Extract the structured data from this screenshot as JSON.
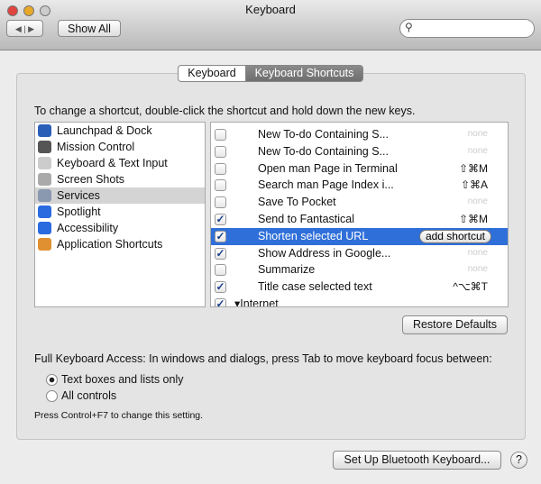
{
  "window": {
    "title": "Keyboard"
  },
  "toolbar": {
    "show_all": "Show All",
    "search_placeholder": ""
  },
  "tabs": [
    {
      "label": "Keyboard",
      "selected": false
    },
    {
      "label": "Keyboard Shortcuts",
      "selected": true
    }
  ],
  "instruction": "To change a shortcut, double-click the shortcut and hold down the new keys.",
  "categories": [
    {
      "label": "Launchpad & Dock",
      "icon": "launchpad-icon",
      "color": "#2a5fb8"
    },
    {
      "label": "Mission Control",
      "icon": "mission-control-icon",
      "color": "#555"
    },
    {
      "label": "Keyboard & Text Input",
      "icon": "keyboard-icon",
      "color": "#ccc"
    },
    {
      "label": "Screen Shots",
      "icon": "screenshot-icon",
      "color": "#aaa"
    },
    {
      "label": "Services",
      "icon": "gear-icon",
      "color": "#8a99b0",
      "selected": true
    },
    {
      "label": "Spotlight",
      "icon": "spotlight-icon",
      "color": "#2b6be0"
    },
    {
      "label": "Accessibility",
      "icon": "accessibility-icon",
      "color": "#2b6be0"
    },
    {
      "label": "Application Shortcuts",
      "icon": "app-shortcuts-icon",
      "color": "#e09030"
    }
  ],
  "shortcuts": [
    {
      "name": "New To-do Containing S...",
      "checked": false,
      "key": "none"
    },
    {
      "name": "New To-do Containing S...",
      "checked": false,
      "key": "none"
    },
    {
      "name": "Open man Page in Terminal",
      "checked": false,
      "key": "⇧⌘M"
    },
    {
      "name": "Search man Page Index i...",
      "checked": false,
      "key": "⇧⌘A"
    },
    {
      "name": "Save To Pocket",
      "checked": false,
      "key": "none"
    },
    {
      "name": "Send to Fantastical",
      "checked": true,
      "key": "⇧⌘M"
    },
    {
      "name": "Shorten selected URL",
      "checked": true,
      "key": "add shortcut",
      "selected": true
    },
    {
      "name": "Show Address in Google...",
      "checked": true,
      "key": "none"
    },
    {
      "name": "Summarize",
      "checked": false,
      "key": "none"
    },
    {
      "name": "Title case selected text",
      "checked": true,
      "key": "^⌥⌘T"
    },
    {
      "name": "▾Internet",
      "checked": true,
      "key": "",
      "group": true
    }
  ],
  "restore_defaults": "Restore Defaults",
  "full_access": {
    "label": "Full Keyboard Access: In windows and dialogs, press Tab to move keyboard focus between:",
    "options": [
      {
        "label": "Text boxes and lists only",
        "selected": true
      },
      {
        "label": "All controls",
        "selected": false
      }
    ],
    "hint": "Press Control+F7 to change this setting."
  },
  "bluetooth_button": "Set Up Bluetooth Keyboard...",
  "help": "?"
}
